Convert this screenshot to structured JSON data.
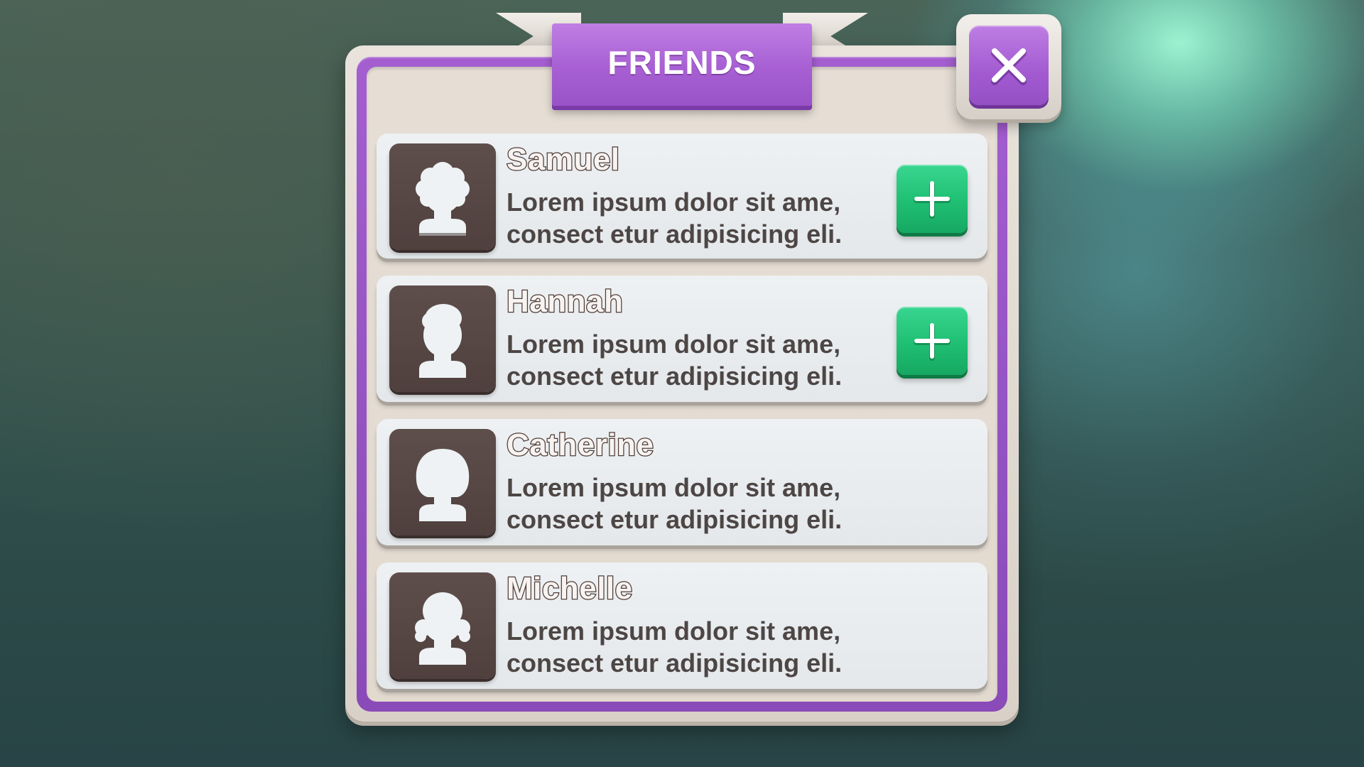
{
  "dialog": {
    "title": "FRIENDS",
    "close_icon": "close-x-icon"
  },
  "colors": {
    "accent_purple": "#a75fd3",
    "add_green": "#1fbf72",
    "avatar_bg": "#574745",
    "card_bg": "#eaeef0",
    "panel_bg": "#e2d9cf"
  },
  "friends": [
    {
      "name": "Samuel",
      "line1": "Lorem ipsum dolor sit ame,",
      "line2": "consect etur adipisicing eli.",
      "avatar_icon": "curly-hair-avatar-icon",
      "has_add_button": true,
      "add_icon": "plus-icon"
    },
    {
      "name": "Hannah",
      "line1": "Lorem ipsum dolor sit ame,",
      "line2": "consect etur adipisicing eli.",
      "avatar_icon": "short-hair-avatar-icon",
      "has_add_button": true,
      "add_icon": "plus-icon"
    },
    {
      "name": "Catherine",
      "line1": "Lorem ipsum dolor sit ame,",
      "line2": "consect etur adipisicing eli.",
      "avatar_icon": "bob-hair-avatar-icon",
      "has_add_button": false
    },
    {
      "name": "Michelle",
      "line1": "Lorem ipsum dolor sit ame,",
      "line2": "consect etur adipisicing eli.",
      "avatar_icon": "wavy-hair-avatar-icon",
      "has_add_button": false
    }
  ]
}
